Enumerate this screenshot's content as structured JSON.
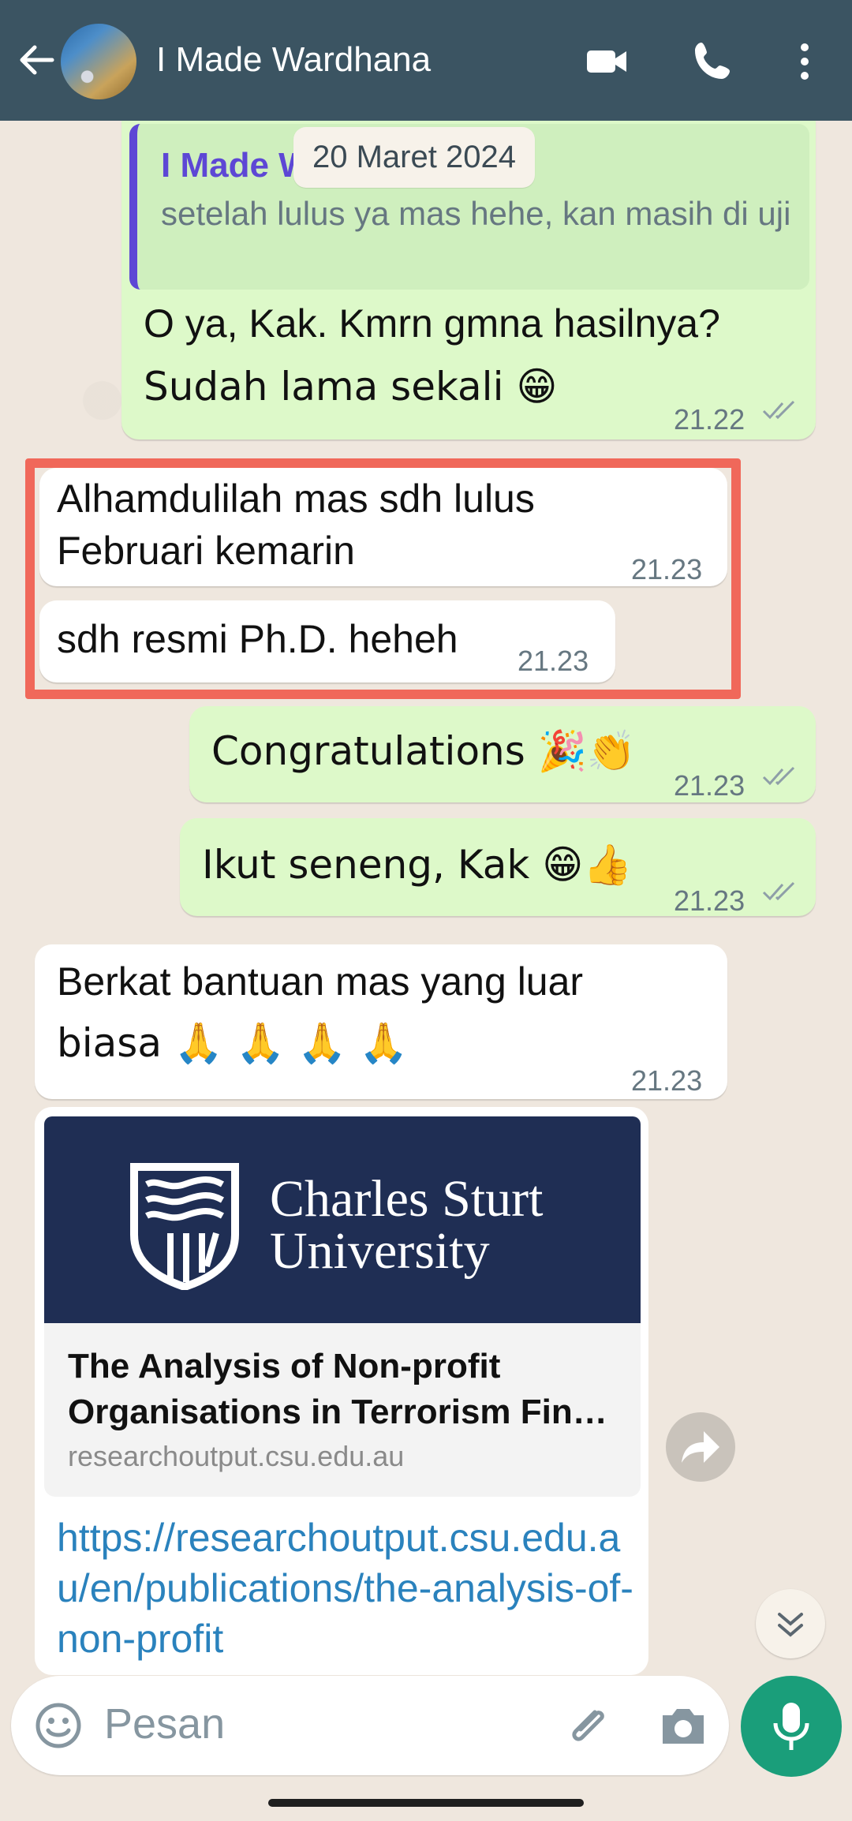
{
  "header": {
    "contact_name": "I Made Wardhana"
  },
  "date_chip": "20 Maret 2024",
  "messages": [
    {
      "direction": "outgoing",
      "quote": {
        "name": "I Made W",
        "text": "setelah lulus ya mas hehe, kan masih di uji"
      },
      "text_line1": "O ya, Kak. Kmrn gmna hasilnya?",
      "text_line2": "Sudah lama sekali 😁",
      "time": "21.22"
    },
    {
      "direction": "incoming",
      "text_line1": "Alhamdulilah mas sdh lulus",
      "text_line2": "Februari kemarin",
      "time": "21.23"
    },
    {
      "direction": "incoming",
      "text": "sdh resmi Ph.D. heheh",
      "time": "21.23"
    },
    {
      "direction": "outgoing",
      "text": "Congratulations 🎉👏",
      "time": "21.23"
    },
    {
      "direction": "outgoing",
      "text": "Ikut seneng, Kak 😁👍",
      "time": "21.23"
    },
    {
      "direction": "incoming",
      "text_line1": "Berkat bantuan mas yang luar",
      "text_line2": "biasa 🙏 🙏 🙏 🙏",
      "time": "21.23"
    }
  ],
  "link_preview": {
    "logo_text": "Charles Sturt\nUniversity",
    "title": "The Analysis of Non-profit Organisations in Terrorism Fin…",
    "domain": "researchoutput.csu.edu.au",
    "url": "https://researchoutput.csu.edu.au/en/publications/the-analysis-of-non-profit"
  },
  "input": {
    "placeholder": "Pesan"
  },
  "colors": {
    "header_bg": "#3B5462",
    "chat_bg": "#EFE7DE",
    "outgoing_bubble": "#DDF9C9",
    "incoming_bubble": "#FFFFFF",
    "highlight_border": "#F0685A",
    "link": "#2A82BD",
    "mic_button": "#1A9E7A"
  },
  "icons": [
    "back-arrow-icon",
    "video-call-icon",
    "phone-call-icon",
    "more-options-icon",
    "double-check-icon",
    "forward-icon",
    "scroll-down-icon",
    "emoji-icon",
    "attach-icon",
    "camera-icon",
    "mic-icon"
  ]
}
